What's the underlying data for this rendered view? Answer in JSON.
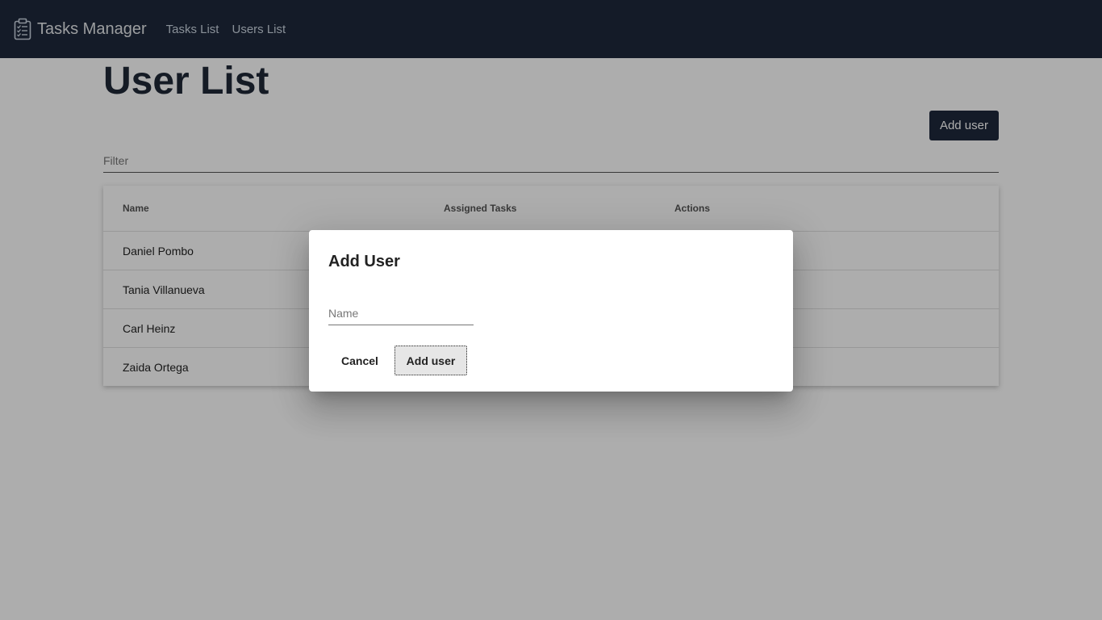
{
  "navbar": {
    "brand": "Tasks Manager",
    "brand_icon": "clipboard-list-icon",
    "links": [
      "Tasks List",
      "Users List"
    ]
  },
  "main": {
    "title": "User List",
    "add_button_label": "Add user",
    "filter_placeholder": "Filter",
    "table": {
      "columns": [
        "Name",
        "Assigned Tasks",
        "Actions"
      ],
      "rows": [
        {
          "name": "Daniel Pombo"
        },
        {
          "name": "Tania Villanueva"
        },
        {
          "name": "Carl Heinz"
        },
        {
          "name": "Zaida Ortega"
        }
      ]
    }
  },
  "dialog": {
    "title": "Add User",
    "name_placeholder": "Name",
    "name_value": "",
    "cancel_label": "Cancel",
    "submit_label": "Add user"
  },
  "colors": {
    "navbar": "#1e293b",
    "primary_button": "#1e293b",
    "overlay": "rgba(0,0,0,0.32)"
  }
}
